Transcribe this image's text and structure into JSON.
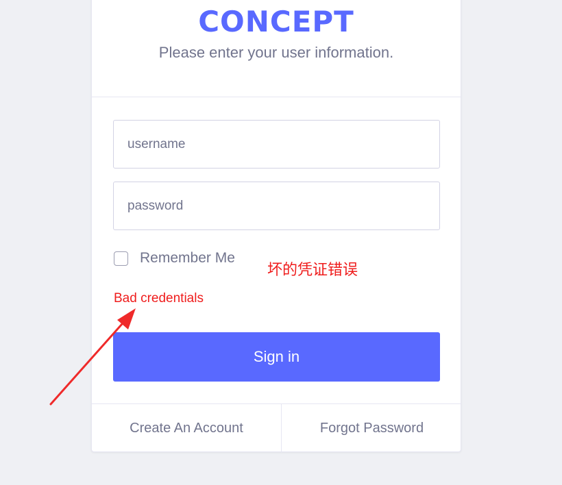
{
  "app": {
    "logo_text": "CONCEPT",
    "subtitle": "Please enter your user information."
  },
  "form": {
    "username": {
      "placeholder": "username",
      "value": ""
    },
    "password": {
      "placeholder": "password",
      "value": ""
    },
    "remember_label": "Remember Me",
    "remember_checked": false,
    "error_text": "Bad credentials",
    "submit_label": "Sign in"
  },
  "footer": {
    "create_account_label": "Create An Account",
    "forgot_password_label": "Forgot Password"
  },
  "annotation": {
    "text": "坏的凭证错误",
    "icon": "arrow-annotation-icon"
  },
  "colors": {
    "brand": "#5969ff",
    "error": "#ef1c1c",
    "text_muted": "#71748d",
    "background": "#eff0f4"
  }
}
